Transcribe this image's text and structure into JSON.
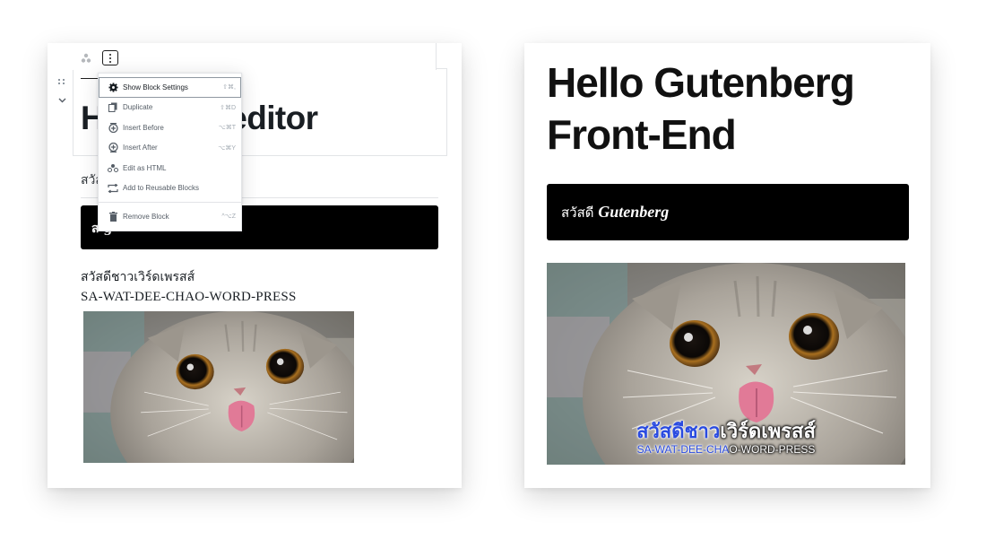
{
  "editor": {
    "heading_visible": "H         enberg editor",
    "paragraph_thai_partial": "สวัส",
    "black_block_partial": "ส          g",
    "thai_line": "สวัสดีชาวเวิร์ดเพรสส์",
    "latin_line": "SA-WAT-DEE-CHAO-WORD-PRESS"
  },
  "menu": {
    "items": [
      {
        "label": "Show Block Settings",
        "shortcut": "⇧⌘,",
        "icon": "gear-icon"
      },
      {
        "label": "Duplicate",
        "shortcut": "⇧⌘D",
        "icon": "duplicate-icon"
      },
      {
        "label": "Insert Before",
        "shortcut": "⌥⌘T",
        "icon": "insert-before-icon"
      },
      {
        "label": "Insert After",
        "shortcut": "⌥⌘Y",
        "icon": "insert-after-icon"
      },
      {
        "label": "Edit as HTML",
        "shortcut": "",
        "icon": "html-icon"
      },
      {
        "label": "Add to Reusable Blocks",
        "shortcut": "",
        "icon": "reusable-icon"
      },
      {
        "label": "Remove Block",
        "shortcut": "^⌥Z",
        "icon": "trash-icon"
      }
    ]
  },
  "frontend": {
    "title": "Hello Gutenberg Front-End",
    "black_block_thai": "สวัสดี",
    "black_block_em": "Gutenberg",
    "overlay_thai_blue": "สวัสดีชาว",
    "overlay_thai_white": "เวิร์ดเพรสส์",
    "overlay_latin_blue": "SA-WAT-DEE-CHA",
    "overlay_latin_white": "O-WORD-PRESS"
  },
  "colors": {
    "overlay_blue": "#2a4be0",
    "block_black": "#000000"
  }
}
